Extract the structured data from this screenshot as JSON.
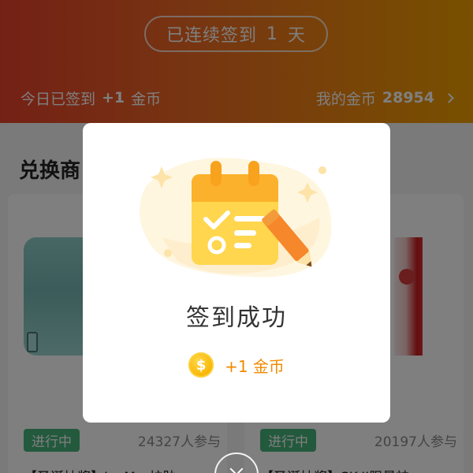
{
  "header": {
    "streak_prefix": "已连续签到",
    "streak_days": "1",
    "streak_suffix": "天",
    "today_label": "今日已签到",
    "today_reward": "+1",
    "today_unit": "金币",
    "coins_label": "我的金币",
    "coins_value": "28954"
  },
  "section": {
    "title": "兑换商"
  },
  "products": [
    {
      "status": "进行中",
      "participants": "24327人参与",
      "title": "【圣诞抽奖】La Mer护肤"
    },
    {
      "status": "进行中",
      "participants": "20197人参与",
      "title": "【圣诞抽奖】SK-II限量神"
    }
  ],
  "modal": {
    "title": "签到成功",
    "coin_symbol": "$",
    "reward_amount": "+1",
    "reward_unit": "金币"
  },
  "colors": {
    "header_gradient_start": "#e8412c",
    "header_gradient_end": "#f0a000",
    "status_tag": "#47b27b",
    "reward_orange": "#f08a00"
  }
}
